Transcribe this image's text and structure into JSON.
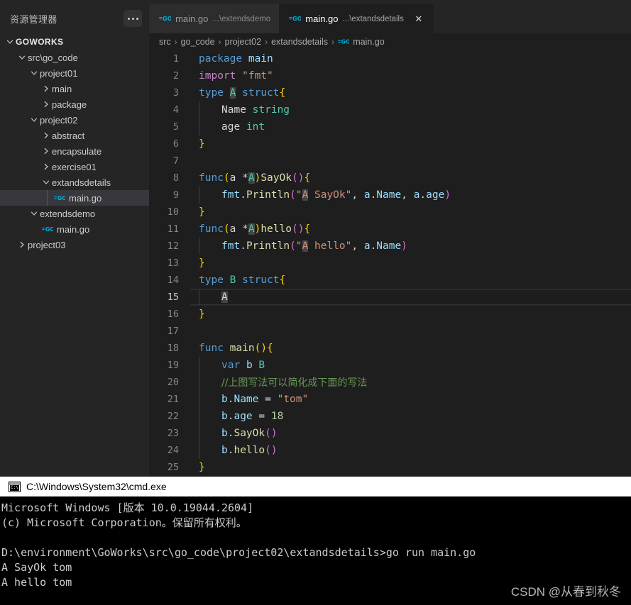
{
  "sidebar": {
    "title": "资源管理器",
    "more_actions": "...",
    "items": [
      {
        "label": "GOWORKS",
        "depth": 0,
        "twisty": "chevron-down",
        "kind": "root",
        "selected": false
      },
      {
        "label": "src\\go_code",
        "depth": 1,
        "twisty": "chevron-down",
        "kind": "folder",
        "selected": false
      },
      {
        "label": "project01",
        "depth": 2,
        "twisty": "chevron-down",
        "kind": "folder",
        "selected": false
      },
      {
        "label": "main",
        "depth": 3,
        "twisty": "chevron-right",
        "kind": "folder",
        "selected": false
      },
      {
        "label": "package",
        "depth": 3,
        "twisty": "chevron-right",
        "kind": "folder",
        "selected": false
      },
      {
        "label": "project02",
        "depth": 2,
        "twisty": "chevron-down",
        "kind": "folder",
        "selected": false
      },
      {
        "label": "abstract",
        "depth": 3,
        "twisty": "chevron-right",
        "kind": "folder",
        "selected": false
      },
      {
        "label": "encapsulate",
        "depth": 3,
        "twisty": "chevron-right",
        "kind": "folder",
        "selected": false
      },
      {
        "label": "exercise01",
        "depth": 3,
        "twisty": "chevron-right",
        "kind": "folder",
        "selected": false
      },
      {
        "label": "extandsdetails",
        "depth": 3,
        "twisty": "chevron-down",
        "kind": "folder",
        "selected": false
      },
      {
        "label": "main.go",
        "depth": 4,
        "twisty": "none",
        "kind": "gofile",
        "selected": true
      },
      {
        "label": "extendsdemo",
        "depth": 2,
        "twisty": "chevron-down",
        "kind": "folder",
        "selected": false
      },
      {
        "label": "main.go",
        "depth": 3,
        "twisty": "none",
        "kind": "gofile",
        "selected": false
      },
      {
        "label": "project03",
        "depth": 1,
        "twisty": "chevron-right",
        "kind": "folder",
        "selected": false
      }
    ]
  },
  "tabs": [
    {
      "name": "main.go",
      "description": "...\\extendsdemo",
      "active": false,
      "icon": "go-file-icon",
      "closable": false
    },
    {
      "name": "main.go",
      "description": "...\\extandsdetails",
      "active": true,
      "icon": "go-file-icon",
      "closable": true,
      "close_label": "✕"
    }
  ],
  "breadcrumb": {
    "separator": "›",
    "items": [
      "src",
      "go_code",
      "project02",
      "extandsdetails",
      "main.go"
    ],
    "file_item_index": 4
  },
  "editor": {
    "active_line": 15,
    "lines": [
      {
        "n": 1,
        "indent": 0,
        "tokens": [
          {
            "t": "package",
            "c": "kw"
          },
          {
            "t": " ",
            "c": "plain"
          },
          {
            "t": "main",
            "c": "var"
          }
        ]
      },
      {
        "n": 2,
        "indent": 0,
        "tokens": [
          {
            "t": "import",
            "c": "kw2"
          },
          {
            "t": " ",
            "c": "plain"
          },
          {
            "t": "\"fmt\"",
            "c": "str"
          }
        ]
      },
      {
        "n": 3,
        "indent": 0,
        "tokens": [
          {
            "t": "type",
            "c": "kw"
          },
          {
            "t": " ",
            "c": "plain"
          },
          {
            "t": "A",
            "c": "type",
            "hl": true
          },
          {
            "t": " ",
            "c": "plain"
          },
          {
            "t": "struct",
            "c": "kw"
          },
          {
            "t": "{",
            "c": "brace-y"
          }
        ]
      },
      {
        "n": 4,
        "indent": 1,
        "tokens": [
          {
            "t": "Name",
            "c": "plain"
          },
          {
            "t": " ",
            "c": "plain"
          },
          {
            "t": "string",
            "c": "type"
          }
        ]
      },
      {
        "n": 5,
        "indent": 1,
        "tokens": [
          {
            "t": "age",
            "c": "plain"
          },
          {
            "t": " ",
            "c": "plain"
          },
          {
            "t": "int",
            "c": "type"
          }
        ]
      },
      {
        "n": 6,
        "indent": 0,
        "tokens": [
          {
            "t": "}",
            "c": "brace-y"
          }
        ]
      },
      {
        "n": 7,
        "indent": 0,
        "tokens": []
      },
      {
        "n": 8,
        "indent": 0,
        "tokens": [
          {
            "t": "func",
            "c": "kw"
          },
          {
            "t": "(",
            "c": "brace-y"
          },
          {
            "t": "a ",
            "c": "plain"
          },
          {
            "t": "*",
            "c": "plain"
          },
          {
            "t": "A",
            "c": "type",
            "hl": true
          },
          {
            "t": ")",
            "c": "brace-y"
          },
          {
            "t": "SayOk",
            "c": "fn"
          },
          {
            "t": "(",
            "c": "brace-p"
          },
          {
            "t": ")",
            "c": "brace-p"
          },
          {
            "t": "{",
            "c": "brace-y"
          }
        ]
      },
      {
        "n": 9,
        "indent": 1,
        "tokens": [
          {
            "t": "fmt",
            "c": "var"
          },
          {
            "t": ".",
            "c": "plain"
          },
          {
            "t": "Println",
            "c": "fn"
          },
          {
            "t": "(",
            "c": "brace-p"
          },
          {
            "t": "\"",
            "c": "str"
          },
          {
            "t": "A",
            "c": "str",
            "hl": true
          },
          {
            "t": " SayOk\"",
            "c": "str"
          },
          {
            "t": ", ",
            "c": "plain"
          },
          {
            "t": "a",
            "c": "var"
          },
          {
            "t": ".",
            "c": "plain"
          },
          {
            "t": "Name",
            "c": "var"
          },
          {
            "t": ", ",
            "c": "plain"
          },
          {
            "t": "a",
            "c": "var"
          },
          {
            "t": ".",
            "c": "plain"
          },
          {
            "t": "age",
            "c": "var"
          },
          {
            "t": ")",
            "c": "brace-p"
          }
        ]
      },
      {
        "n": 10,
        "indent": 0,
        "tokens": [
          {
            "t": "}",
            "c": "brace-y"
          }
        ]
      },
      {
        "n": 11,
        "indent": 0,
        "tokens": [
          {
            "t": "func",
            "c": "kw"
          },
          {
            "t": "(",
            "c": "brace-y"
          },
          {
            "t": "a ",
            "c": "plain"
          },
          {
            "t": "*",
            "c": "plain"
          },
          {
            "t": "A",
            "c": "type",
            "hl": true
          },
          {
            "t": ")",
            "c": "brace-y"
          },
          {
            "t": "hello",
            "c": "fn"
          },
          {
            "t": "(",
            "c": "brace-p"
          },
          {
            "t": ")",
            "c": "brace-p"
          },
          {
            "t": "{",
            "c": "brace-y"
          }
        ]
      },
      {
        "n": 12,
        "indent": 1,
        "tokens": [
          {
            "t": "fmt",
            "c": "var"
          },
          {
            "t": ".",
            "c": "plain"
          },
          {
            "t": "Println",
            "c": "fn"
          },
          {
            "t": "(",
            "c": "brace-p"
          },
          {
            "t": "\"",
            "c": "str"
          },
          {
            "t": "A",
            "c": "str",
            "hl": true
          },
          {
            "t": " hello\"",
            "c": "str"
          },
          {
            "t": ", ",
            "c": "plain"
          },
          {
            "t": "a",
            "c": "var"
          },
          {
            "t": ".",
            "c": "plain"
          },
          {
            "t": "Name",
            "c": "var"
          },
          {
            "t": ")",
            "c": "brace-p"
          }
        ]
      },
      {
        "n": 13,
        "indent": 0,
        "tokens": [
          {
            "t": "}",
            "c": "brace-y"
          }
        ]
      },
      {
        "n": 14,
        "indent": 0,
        "tokens": [
          {
            "t": "type",
            "c": "kw"
          },
          {
            "t": " ",
            "c": "plain"
          },
          {
            "t": "B",
            "c": "type"
          },
          {
            "t": " ",
            "c": "plain"
          },
          {
            "t": "struct",
            "c": "kw"
          },
          {
            "t": "{",
            "c": "brace-y"
          }
        ]
      },
      {
        "n": 15,
        "indent": 1,
        "tokens": [
          {
            "t": "A",
            "c": "plain",
            "hl": true
          }
        ]
      },
      {
        "n": 16,
        "indent": 0,
        "tokens": [
          {
            "t": "}",
            "c": "brace-y"
          }
        ]
      },
      {
        "n": 17,
        "indent": 0,
        "tokens": []
      },
      {
        "n": 18,
        "indent": 0,
        "tokens": [
          {
            "t": "func",
            "c": "kw"
          },
          {
            "t": " ",
            "c": "plain"
          },
          {
            "t": "main",
            "c": "fn"
          },
          {
            "t": "(",
            "c": "brace-y"
          },
          {
            "t": ")",
            "c": "brace-y"
          },
          {
            "t": "{",
            "c": "brace-y"
          }
        ]
      },
      {
        "n": 19,
        "indent": 1,
        "tokens": [
          {
            "t": "var",
            "c": "kw"
          },
          {
            "t": " ",
            "c": "plain"
          },
          {
            "t": "b",
            "c": "var"
          },
          {
            "t": " ",
            "c": "plain"
          },
          {
            "t": "B",
            "c": "type"
          }
        ]
      },
      {
        "n": 20,
        "indent": 1,
        "tokens": [
          {
            "t": "//上图写法可以简化成下面的写法",
            "c": "cmt"
          }
        ]
      },
      {
        "n": 21,
        "indent": 1,
        "tokens": [
          {
            "t": "b",
            "c": "var"
          },
          {
            "t": ".",
            "c": "plain"
          },
          {
            "t": "Name",
            "c": "var"
          },
          {
            "t": " = ",
            "c": "plain"
          },
          {
            "t": "\"tom\"",
            "c": "str"
          }
        ]
      },
      {
        "n": 22,
        "indent": 1,
        "tokens": [
          {
            "t": "b",
            "c": "var"
          },
          {
            "t": ".",
            "c": "plain"
          },
          {
            "t": "age",
            "c": "var"
          },
          {
            "t": " = ",
            "c": "plain"
          },
          {
            "t": "18",
            "c": "num"
          }
        ]
      },
      {
        "n": 23,
        "indent": 1,
        "tokens": [
          {
            "t": "b",
            "c": "var"
          },
          {
            "t": ".",
            "c": "plain"
          },
          {
            "t": "SayOk",
            "c": "fn"
          },
          {
            "t": "(",
            "c": "brace-p"
          },
          {
            "t": ")",
            "c": "brace-p"
          }
        ]
      },
      {
        "n": 24,
        "indent": 1,
        "tokens": [
          {
            "t": "b",
            "c": "var"
          },
          {
            "t": ".",
            "c": "plain"
          },
          {
            "t": "hello",
            "c": "fn"
          },
          {
            "t": "(",
            "c": "brace-p"
          },
          {
            "t": ")",
            "c": "brace-p"
          }
        ]
      },
      {
        "n": 25,
        "indent": 0,
        "tokens": [
          {
            "t": "}",
            "c": "brace-y"
          }
        ]
      }
    ]
  },
  "terminal": {
    "title": "C:\\Windows\\System32\\cmd.exe",
    "icon": "cmd-console-icon",
    "icon_text": "C:\\",
    "lines": [
      "Microsoft Windows [版本 10.0.19044.2604]",
      "(c) Microsoft Corporation。保留所有权利。",
      "",
      "D:\\environment\\GoWorks\\src\\go_code\\project02\\extandsdetails>go run main.go",
      "A SayOk tom",
      "A hello tom"
    ]
  },
  "watermark": "CSDN @从春到秋冬",
  "colors": {
    "sidebar_bg": "#252526",
    "editor_bg": "#1e1e1e",
    "tab_active_bg": "#1e1e1e",
    "tab_inactive_bg": "#2d2d2d",
    "selected_row_bg": "#37373d",
    "terminal_bg": "#000000",
    "terminal_title_bg": "#ffffff",
    "go_icon_blue": "#00acd7",
    "comment_green": "#6a9955",
    "string_orange": "#ce9178",
    "keyword_blue": "#569cd6",
    "type_teal": "#4ec9b0"
  }
}
